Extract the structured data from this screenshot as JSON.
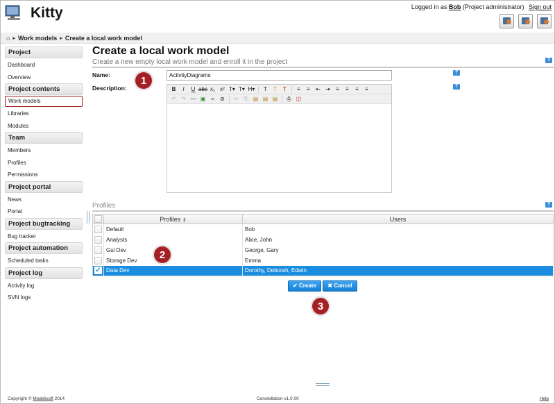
{
  "header": {
    "app_title": "Kitty",
    "logged_in_prefix": "Logged in as",
    "user": "Bob",
    "role": "(Project administrator)",
    "signout": "Sign out",
    "icons": [
      "user-settings-icon",
      "user-admin-icon",
      "user-profile-icon"
    ]
  },
  "breadcrumb": {
    "items": [
      "Work models",
      "Create a local work model"
    ]
  },
  "sidebar": {
    "sections": [
      {
        "title": "Project",
        "items": [
          "Dashboard",
          "Overview"
        ]
      },
      {
        "title": "Project contents",
        "items": [
          "Work models",
          "Libraries",
          "Modules"
        ]
      },
      {
        "title": "Team",
        "items": [
          "Members",
          "Profiles",
          "Permissions"
        ]
      },
      {
        "title": "Project portal",
        "items": [
          "News",
          "Portal"
        ]
      },
      {
        "title": "Project bugtracking",
        "items": [
          "Bug tracker"
        ]
      },
      {
        "title": "Project automation",
        "items": [
          "Scheduled tasks"
        ]
      },
      {
        "title": "Project log",
        "items": [
          "Activity log",
          "SVN logs"
        ]
      }
    ],
    "active_item": "Work models"
  },
  "main": {
    "title": "Create a local work model",
    "subtitle": "Create a new empty local work model and enroll it in the project",
    "name_label": "Name:",
    "name_value": "ActivityDiagrams",
    "description_label": "Description:",
    "help": "?",
    "profiles_label": "Profiles",
    "grid_headers": {
      "profiles": "Profiles",
      "users": "Users"
    },
    "rows": [
      {
        "profile": "Default",
        "users": "Bob",
        "checked": false
      },
      {
        "profile": "Analysts",
        "users": "Alice, John",
        "checked": false
      },
      {
        "profile": "Gui Dev",
        "users": "George, Gary",
        "checked": false
      },
      {
        "profile": "Storage Dev",
        "users": "Emma",
        "checked": false
      },
      {
        "profile": "Data Dev",
        "users": "Dorothy, Deborah, Edwin",
        "checked": true
      }
    ],
    "create_label": "Create",
    "cancel_label": "Cancel"
  },
  "badges": [
    "1",
    "2",
    "3"
  ],
  "footer": {
    "copyright": "Copyright ©",
    "company": "Modelisoft",
    "year": "2014",
    "version": "Constellation v1.0.00",
    "help": "Help"
  },
  "colors": {
    "accent": "#1a8de0",
    "badge": "#a52024",
    "active_border": "#a01818"
  }
}
